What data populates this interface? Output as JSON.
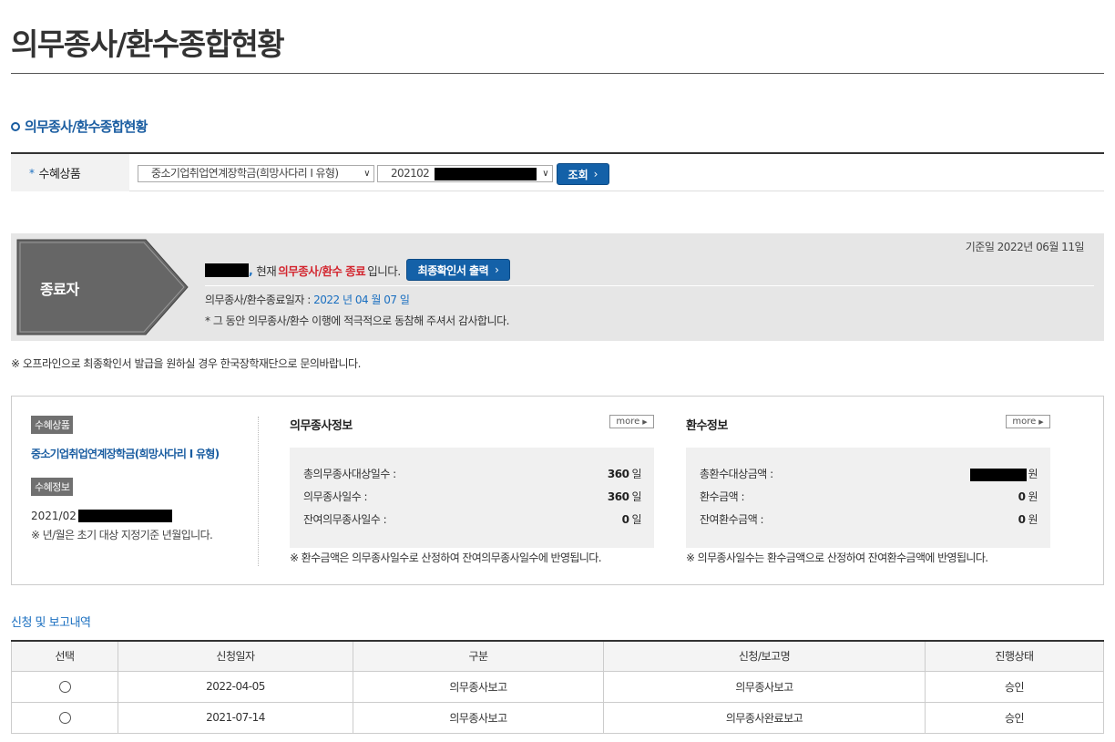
{
  "page": {
    "title": "의무종사/환수종합현황"
  },
  "section": {
    "title": "의무종사/환수종합현황"
  },
  "search": {
    "label": "수혜상품",
    "required_mark": "*",
    "product_select": "중소기업취업연계장학금(희망사다리 I 유형)",
    "period_select_prefix": "202102",
    "button_label": "조회"
  },
  "status": {
    "badge": "종료자",
    "base_date": "기준일 2022년 06월 11일",
    "line_suffix_comma": ",",
    "current_text": "현재",
    "highlight": "의무종사/환수 종료",
    "tail_text": "입니다.",
    "cert_button": "최종확인서 출력",
    "end_date_label": "의무종사/환수종료일자 :",
    "end_date_value": "2022 년 04 월 07 일",
    "thanks": "* 그 동안 의무종사/환수 이행에 적극적으로 동참해 주셔서 감사합니다."
  },
  "offline_note": "※ 오프라인으로 최종확인서 발급을 원하실 경우 한국장학재단으로 문의바랍니다.",
  "benefit": {
    "product_tag": "수혜상품",
    "product_name": "중소기업취업연계장학금(희망사다리 I 유형)",
    "info_tag": "수혜정보",
    "period_prefix": "2021/02",
    "period_note": "※ 년/월은 초기 대상 지정기준 년월입니다."
  },
  "duty": {
    "title": "의무종사정보",
    "more": "more",
    "rows": [
      {
        "label": "총의무종사대상일수 :",
        "value": "360",
        "unit": "일"
      },
      {
        "label": "의무종사일수 :",
        "value": "360",
        "unit": "일"
      },
      {
        "label": "잔여의무종사일수 :",
        "value": "0",
        "unit": "일"
      }
    ],
    "note": "※ 환수금액은 의무종사일수로 산정하여 잔여의무종사일수에 반영됩니다."
  },
  "refund": {
    "title": "환수정보",
    "more": "more",
    "rows": [
      {
        "label": "총환수대상금액 :",
        "value": "",
        "unit": "원"
      },
      {
        "label": "환수금액 :",
        "value": "0",
        "unit": "원"
      },
      {
        "label": "잔여환수금액 :",
        "value": "0",
        "unit": "원"
      }
    ],
    "note": "※ 의무종사일수는 환수금액으로 산정하여 잔여환수금액에 반영됩니다."
  },
  "history": {
    "title": "신청 및 보고내역",
    "headers": [
      "선택",
      "신청일자",
      "구분",
      "신청/보고명",
      "진행상태"
    ],
    "rows": [
      {
        "date": "2022-04-05",
        "type": "의무종사보고",
        "name": "의무종사보고",
        "status": "승인"
      },
      {
        "date": "2021-07-14",
        "type": "의무종사보고",
        "name": "의무종사완료보고",
        "status": "승인"
      }
    ]
  },
  "colors": {
    "accent": "#1461a8",
    "highlight": "#d3262f",
    "link": "#1a6fc0"
  },
  "icons": {
    "section_bullet": "ring-bullet-icon",
    "select_arrow": "chevron-down-icon",
    "button_arrow": "chevron-right-icon",
    "more_arrow": "triangle-right-icon"
  }
}
